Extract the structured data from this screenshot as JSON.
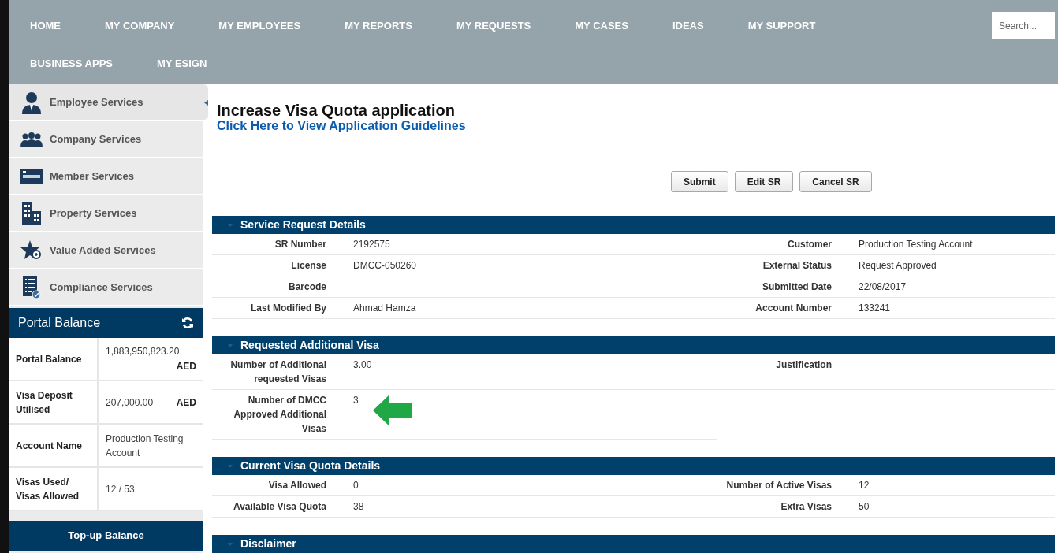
{
  "nav_rows": [
    [
      "HOME",
      "MY COMPANY",
      "MY EMPLOYEES",
      "MY REPORTS",
      "MY REQUESTS",
      "MY CASES",
      "IDEAS",
      "MY SUPPORT"
    ],
    [
      "BUSINESS APPS",
      "MY ESIGN"
    ]
  ],
  "search": {
    "placeholder": "Search..."
  },
  "sidebar": {
    "items": [
      {
        "label": "Employee Services",
        "selected": true
      },
      {
        "label": "Company Services",
        "selected": false
      },
      {
        "label": "Member Services",
        "selected": false
      },
      {
        "label": "Property Services",
        "selected": false
      },
      {
        "label": "Value Added Services",
        "selected": false
      },
      {
        "label": "Compliance Services",
        "selected": false
      }
    ]
  },
  "balance": {
    "title": "Portal Balance",
    "rows": [
      {
        "label": "Portal Balance",
        "value": "1,883,950,823.20",
        "unit": "AED"
      },
      {
        "label": "Visa Deposit Utilised",
        "value": "207,000.00",
        "unit": "AED"
      },
      {
        "label": "Account Name",
        "value": "Production Testing Account"
      },
      {
        "label": "Visas Used/ Visas Allowed",
        "value": "12 / 53"
      }
    ],
    "button": "Top-up Balance"
  },
  "page": {
    "title": "Increase Visa Quota application",
    "link": "Click Here to View Application Guidelines"
  },
  "buttons": [
    "Submit",
    "Edit SR",
    "Cancel SR"
  ],
  "sections": [
    {
      "title": "Service Request Details",
      "left": [
        {
          "label": "SR Number",
          "value": "2192575"
        },
        {
          "label": "License",
          "value": "DMCC-050260"
        },
        {
          "label": "Barcode"
        },
        {
          "label": "Last Modified By",
          "value": "Ahmad Hamza"
        }
      ],
      "right": [
        {
          "label": "Customer",
          "value": "Production Testing Account"
        },
        {
          "label": "External Status",
          "value": "Request Approved"
        },
        {
          "label": "Submitted Date",
          "value": "22/08/2017"
        },
        {
          "label": "Account Number",
          "value": "133241"
        }
      ]
    },
    {
      "title": "Requested Additional Visa",
      "left": [
        {
          "label": "Number of Additional requested Visas",
          "value": "3.00"
        },
        {
          "label": "Number of DMCC Approved Additional Visas",
          "value": "3",
          "arrow": true
        }
      ],
      "right": [
        {
          "label": "Justification"
        }
      ]
    },
    {
      "title": "Current Visa Quota Details",
      "left": [
        {
          "label": "Visa Allowed",
          "value": "0"
        },
        {
          "label": "Available Visa Quota",
          "value": "38"
        }
      ],
      "right": [
        {
          "label": "Number of Active Visas",
          "value": "12"
        },
        {
          "label": "Extra Visas",
          "value": "50"
        }
      ]
    },
    {
      "title": "Disclaimer"
    }
  ]
}
